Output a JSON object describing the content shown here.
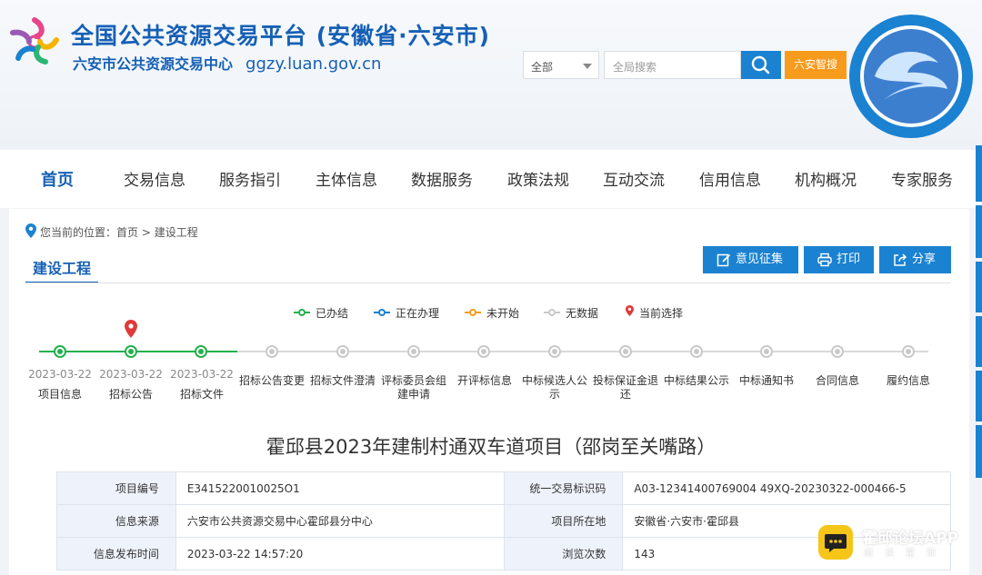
{
  "header": {
    "title": "全国公共资源交易平台 (安徽省·六安市)",
    "subtitle": "六安市公共资源交易中心",
    "domain": "ggzy.luan.gov.cn",
    "scope_value": "全部",
    "search_placeholder": "全局搜索",
    "smart_button": "六安智搜",
    "brand_color": "#1660b5",
    "accent_color": "#f79b1c"
  },
  "nav": {
    "items": [
      "首页",
      "交易信息",
      "服务指引",
      "主体信息",
      "数据服务",
      "政策法规",
      "互动交流",
      "信用信息",
      "机构概况",
      "专家服务"
    ],
    "active_index": 0
  },
  "breadcrumb": {
    "prefix": "您当前的位置：",
    "path": [
      "首页",
      "建设工程"
    ],
    "separator": ">"
  },
  "page_tab": "建设工程",
  "actions": {
    "feedback": "意见征集",
    "print": "打印",
    "share": "分享"
  },
  "legend": {
    "done": "已办结",
    "in_progress": "正在办理",
    "not_started": "未开始",
    "no_data": "无数据",
    "current": "当前选择",
    "colors": {
      "done": "#22b14c",
      "in_progress": "#1b82d1",
      "not_started": "#f79b1c",
      "no_data": "#c9c9c9",
      "current": "#e03a3a"
    }
  },
  "steps": [
    {
      "label": "项目信息",
      "date": "2023-03-22",
      "status": "done"
    },
    {
      "label": "招标公告",
      "date": "2023-03-22",
      "status": "done",
      "current": true
    },
    {
      "label": "招标文件",
      "date": "2023-03-22",
      "status": "done"
    },
    {
      "label": "招标公告变更",
      "date": "",
      "status": "no-data"
    },
    {
      "label": "招标文件澄清",
      "date": "",
      "status": "no-data"
    },
    {
      "label": "评标委员会组建申请",
      "date": "",
      "status": "no-data"
    },
    {
      "label": "开评标信息",
      "date": "",
      "status": "no-data"
    },
    {
      "label": "中标候选人公示",
      "date": "",
      "status": "no-data"
    },
    {
      "label": "投标保证金退还",
      "date": "",
      "status": "no-data"
    },
    {
      "label": "中标结果公示",
      "date": "",
      "status": "no-data"
    },
    {
      "label": "中标通知书",
      "date": "",
      "status": "no-data"
    },
    {
      "label": "合同信息",
      "date": "",
      "status": "no-data"
    },
    {
      "label": "履约信息",
      "date": "",
      "status": "no-data"
    }
  ],
  "project": {
    "title": "霍邱县2023年建制村通双车道项目（邵岗至关嘴路）",
    "rows": [
      {
        "k1": "项目编号",
        "v1": "E3415220010025O1",
        "k2": "统一交易标识码",
        "v2": "A03-12341400769004 49XQ-20230322-000466-5"
      },
      {
        "k1": "信息来源",
        "v1": "六安市公共资源交易中心霍邱县分中心",
        "k2": "项目所在地",
        "v2": "安徽省·六安市·霍邱县"
      },
      {
        "k1": "信息发布时间",
        "v1": "2023-03-22 14:57:20",
        "k2": "浏览次数",
        "v2": "143"
      }
    ]
  },
  "watermark": {
    "title": "霍邱论坛APP",
    "sub": "阅读霍邱"
  }
}
